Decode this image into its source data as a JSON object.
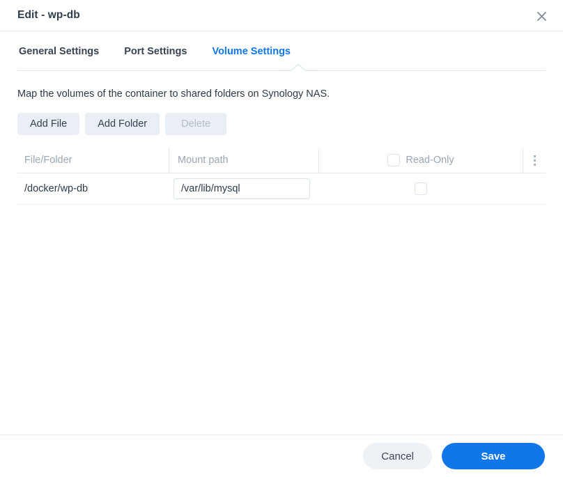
{
  "window": {
    "title": "Edit - wp-db",
    "close_icon": "close-icon"
  },
  "tabs": [
    {
      "label": "General Settings",
      "active": false
    },
    {
      "label": "Port Settings",
      "active": false
    },
    {
      "label": "Volume Settings",
      "active": true
    }
  ],
  "main": {
    "description": "Map the volumes of the container to shared folders on Synology NAS.",
    "toolbar": {
      "add_file_label": "Add File",
      "add_folder_label": "Add Folder",
      "delete_label": "Delete",
      "delete_disabled": true
    },
    "table": {
      "columns": [
        {
          "key": "file_folder",
          "label": "File/Folder"
        },
        {
          "key": "mount_path",
          "label": "Mount path"
        },
        {
          "key": "read_only",
          "label": "Read-Only"
        }
      ],
      "header_read_only_checked": false,
      "menu_icon": "kebab-menu-icon",
      "rows": [
        {
          "file_folder": "/docker/wp-db",
          "mount_path": "/var/lib/mysql",
          "mount_path_placeholder": "Mount path",
          "read_only": false
        }
      ]
    }
  },
  "footer": {
    "cancel_label": "Cancel",
    "save_label": "Save"
  },
  "colors": {
    "accent": "#1177e8",
    "text": "#2e3a47",
    "muted": "#9aa6b4",
    "border": "#e0e8f0",
    "button_bg": "#eaeff5",
    "cancel_bg": "#eef1f5"
  }
}
